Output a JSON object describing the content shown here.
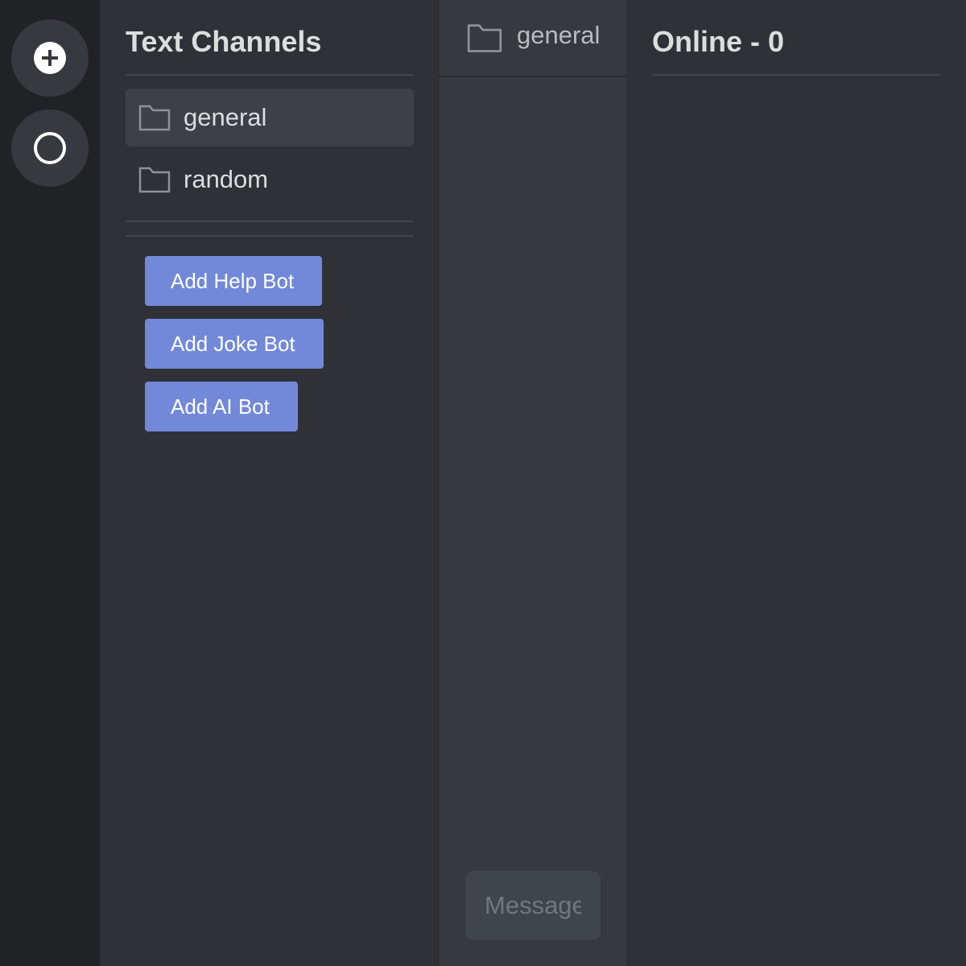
{
  "server_rail": {
    "items": [
      {
        "name": "add-server",
        "icon": "plus-icon"
      },
      {
        "name": "home-server",
        "icon": "circle-icon"
      }
    ]
  },
  "sidebar": {
    "title": "Text Channels",
    "channels": [
      {
        "label": "general",
        "icon": "folder-icon",
        "active": true
      },
      {
        "label": "random",
        "icon": "folder-icon",
        "active": false
      }
    ],
    "bot_buttons": [
      {
        "label": "Add Help Bot"
      },
      {
        "label": "Add Joke Bot"
      },
      {
        "label": "Add AI Bot"
      }
    ]
  },
  "chat": {
    "channel_name": "general",
    "message_placeholder": "Message"
  },
  "members": {
    "title": "Online - 0"
  },
  "colors": {
    "accent": "#7289da",
    "rail_bg": "#202225",
    "sidebar_bg": "#2f3136",
    "chat_bg": "#36393f"
  }
}
